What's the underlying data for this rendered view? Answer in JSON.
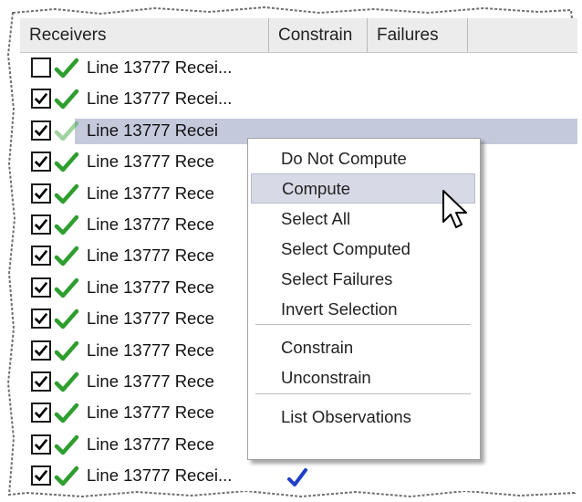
{
  "table": {
    "columns": [
      "Receivers",
      "Constrain",
      "Failures"
    ],
    "rows": [
      {
        "text": "Line 13777 Recei...",
        "checked": false,
        "selected": false
      },
      {
        "text": "Line 13777 Recei...",
        "checked": true,
        "selected": false
      },
      {
        "text": "Line 13777 Recei",
        "checked": true,
        "selected": true
      },
      {
        "text": "Line 13777 Rece",
        "checked": true,
        "selected": false
      },
      {
        "text": "Line 13777 Rece",
        "checked": true,
        "selected": false
      },
      {
        "text": "Line 13777 Rece",
        "checked": true,
        "selected": false
      },
      {
        "text": "Line 13777 Rece",
        "checked": true,
        "selected": false
      },
      {
        "text": "Line 13777 Rece",
        "checked": true,
        "selected": false
      },
      {
        "text": "Line 13777 Rece",
        "checked": true,
        "selected": false
      },
      {
        "text": "Line 13777 Rece",
        "checked": true,
        "selected": false
      },
      {
        "text": "Line 13777 Rece",
        "checked": true,
        "selected": false
      },
      {
        "text": "Line 13777 Rece",
        "checked": true,
        "selected": false
      },
      {
        "text": "Line 13777 Rece",
        "checked": true,
        "selected": false
      },
      {
        "text": "Line 13777 Recei...",
        "checked": true,
        "selected": false,
        "constrain_check": true
      }
    ]
  },
  "context_menu": {
    "items": [
      {
        "label": "Do Not Compute",
        "hover": false
      },
      {
        "label": "Compute",
        "hover": true
      },
      {
        "label": "Select All",
        "hover": false
      },
      {
        "label": "Select Computed",
        "hover": false
      },
      {
        "label": "Select Failures",
        "hover": false
      },
      {
        "label": "Invert Selection",
        "hover": false
      },
      {
        "label": "Constrain",
        "hover": false
      },
      {
        "label": "Unconstrain",
        "hover": false
      },
      {
        "label": "List Observations",
        "hover": false
      }
    ]
  },
  "colors": {
    "green_check": "#2e9e2e",
    "blue_check": "#1f3fc8",
    "selection": "#c5c9dc",
    "menu_hover": "#d7d9e6"
  },
  "icons": {
    "status": "green-checkmark-icon",
    "constrain": "blue-checkmark-icon",
    "pointer": "mouse-pointer-icon"
  }
}
